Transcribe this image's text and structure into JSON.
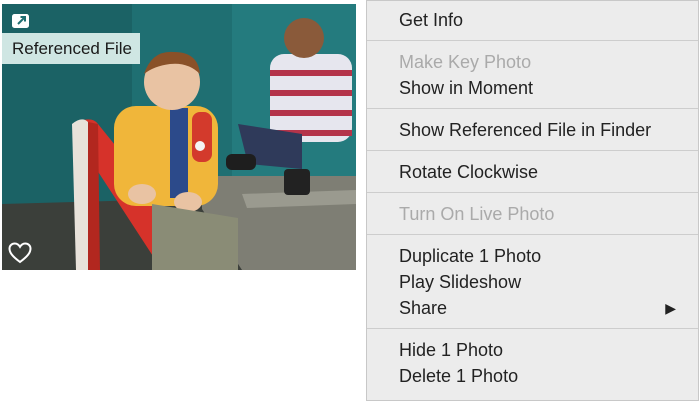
{
  "photo": {
    "label": "Referenced File",
    "badge_icon": "referenced-file-arrow-icon",
    "heart_icon": "heart-outline-icon"
  },
  "menu": {
    "get_info": "Get Info",
    "make_key_photo": "Make Key Photo",
    "show_in_moment": "Show in Moment",
    "show_referenced": "Show Referenced File in Finder",
    "rotate_clockwise": "Rotate Clockwise",
    "turn_on_live": "Turn On Live Photo",
    "duplicate": "Duplicate 1 Photo",
    "play_slideshow": "Play Slideshow",
    "share": "Share",
    "share_arrow": "▶",
    "hide": "Hide 1 Photo",
    "delete": "Delete 1 Photo"
  },
  "colors": {
    "menu_bg": "#ececec",
    "disabled_text": "#aaaaaa",
    "label_bg": "#cfe6e3"
  }
}
